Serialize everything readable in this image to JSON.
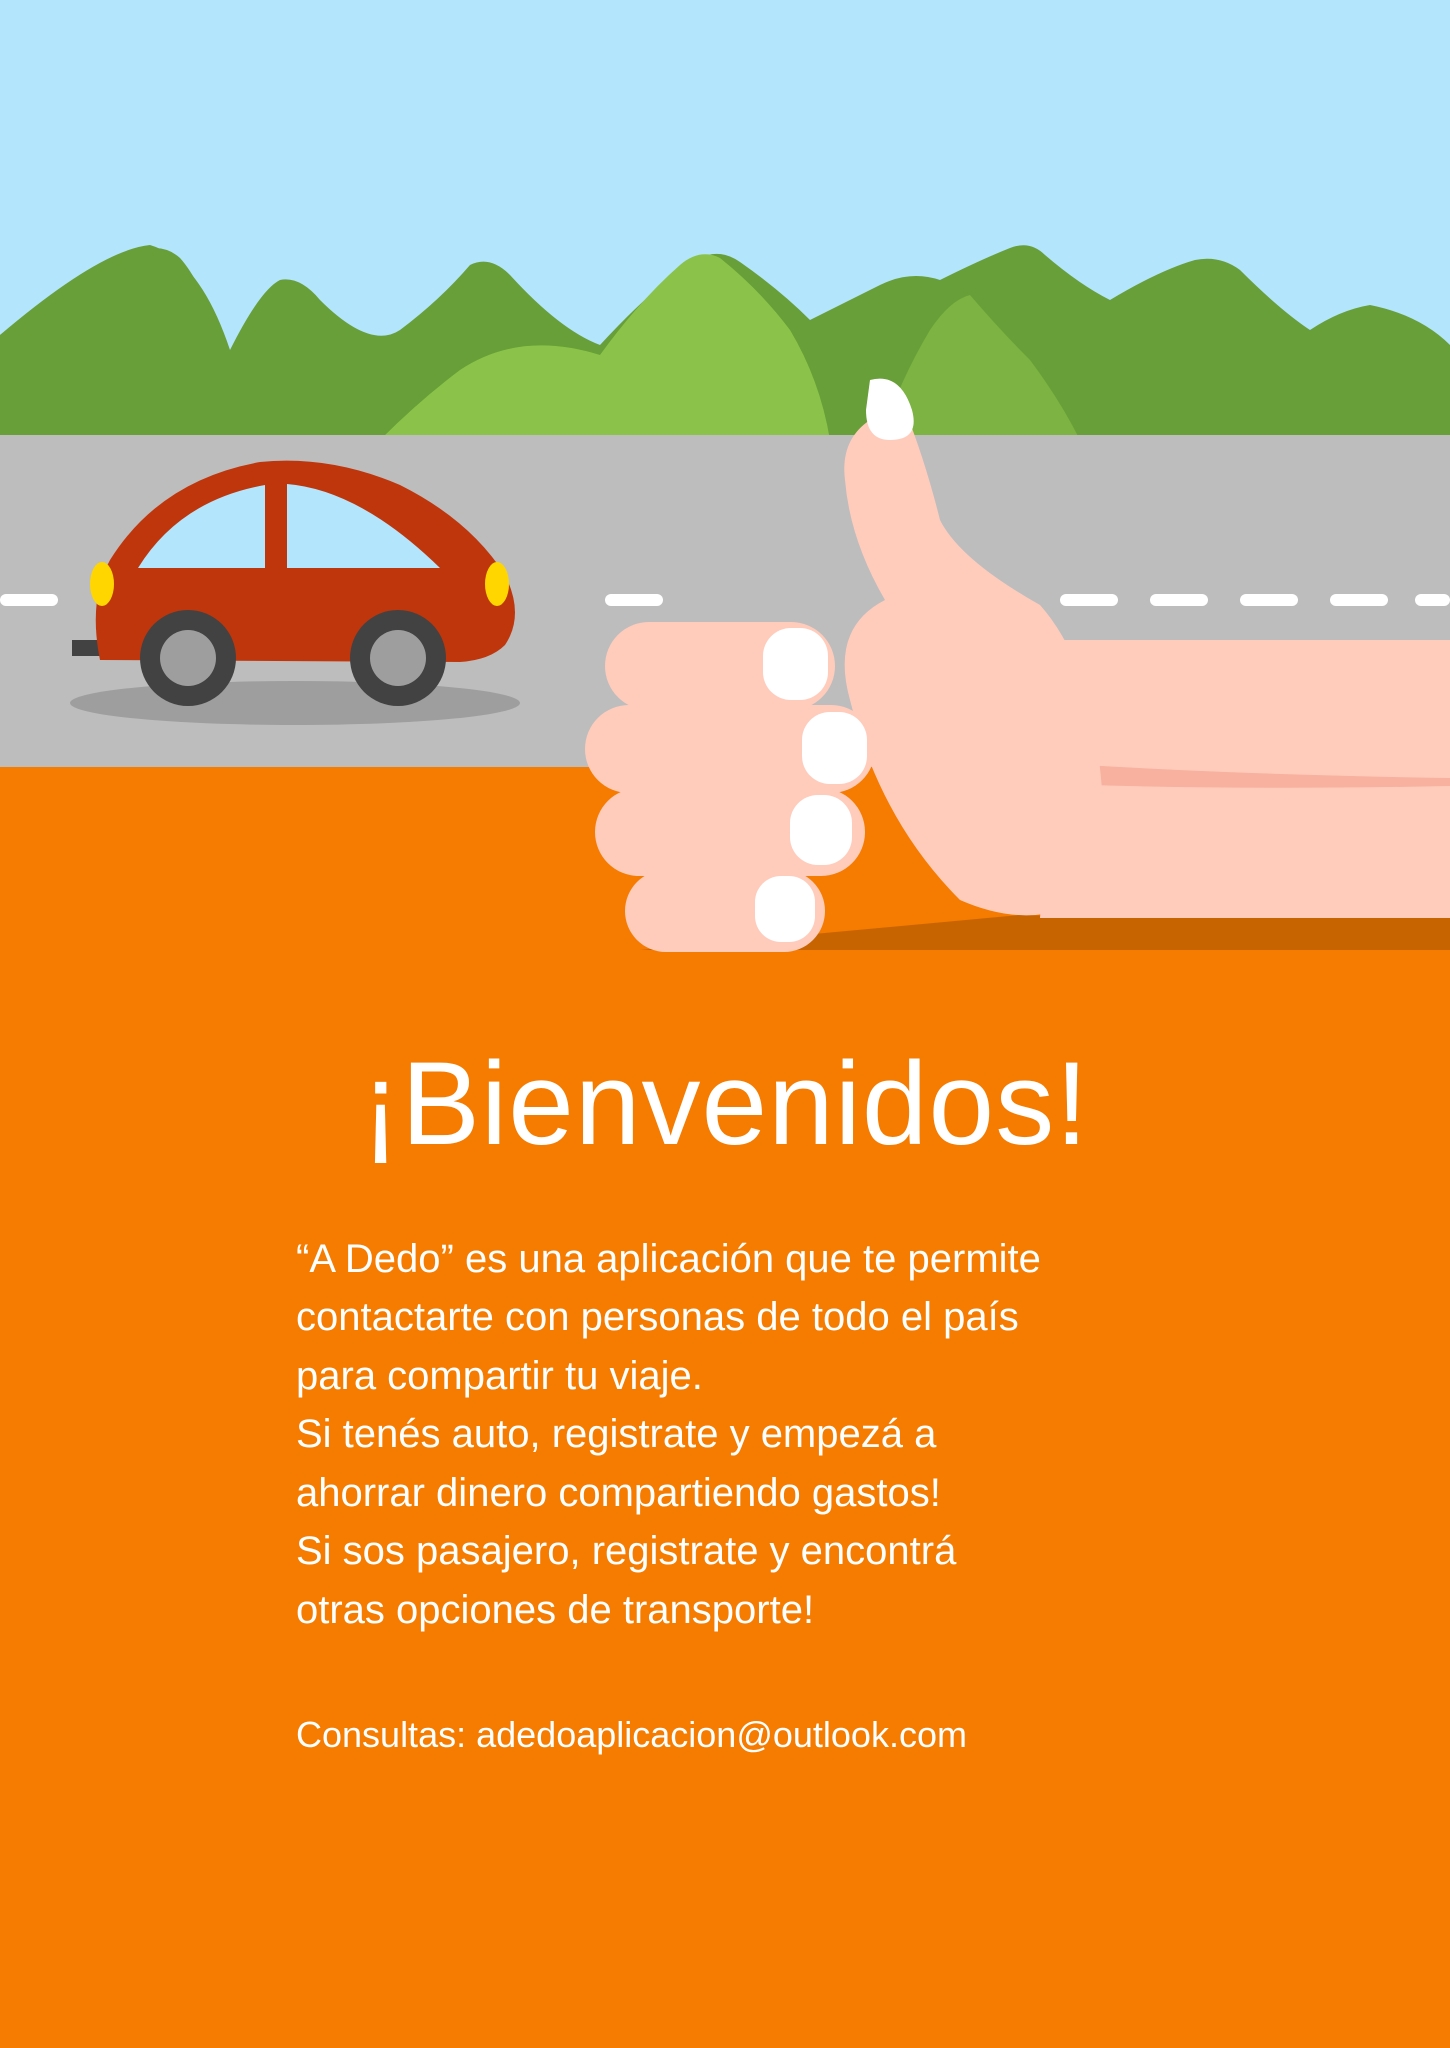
{
  "welcome": {
    "title": "¡Bienvenidos!",
    "lines": [
      "“A Dedo” es una aplicación que te permite",
      "contactarte con personas de todo el país",
      "para compartir tu viaje.",
      "Si tenés auto, registrate y empezá a",
      "ahorrar dinero compartiendo gastos!",
      "Si sos pasajero, registrate y encontrá",
      "otras opciones de transporte!"
    ],
    "contact_label": "Consultas:",
    "contact_email": "adedoaplicacion@outlook.com"
  },
  "colors": {
    "sky": "#b3e5fc",
    "hills_dark": "#689f38",
    "hills_light": "#8bc34a",
    "road": "#bdbdbd",
    "background": "#f57c00",
    "car_body": "#bf360c",
    "headlight": "#ffd600",
    "skin": "#ffccbc"
  },
  "icons": [
    "car-icon",
    "thumbs-up-hand-icon"
  ]
}
